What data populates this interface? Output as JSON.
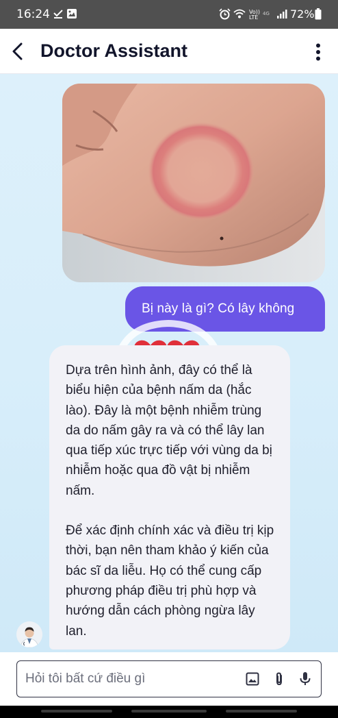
{
  "status_bar": {
    "time": "16:24",
    "battery": "72%",
    "left_icons": [
      "download-done-icon",
      "image-icon"
    ],
    "right_icons": [
      "alarm-icon",
      "wifi-icon",
      "volte-icon",
      "signal-icon",
      "battery-icon"
    ]
  },
  "header": {
    "title": "Doctor Assistant",
    "back_icon": "back-arrow-icon",
    "menu_icon": "more-vertical-icon"
  },
  "chat": {
    "messages": [
      {
        "role": "user",
        "type": "image",
        "description_icon": "photo"
      },
      {
        "role": "user",
        "type": "text",
        "text": "Bị này là gì? Có lây không"
      },
      {
        "role": "assistant",
        "type": "text",
        "paragraphs": [
          "Dựa trên hình ảnh, đây có thể là biểu hiện của bệnh nấm da (hắc lào). Đây là một bệnh nhiễm trùng da do nấm gây ra và có thể lây lan qua tiếp xúc trực tiếp với vùng da bị nhiễm hoặc qua đồ vật bị nhiễm nấm.",
          "Để xác định chính xác và điều trị kịp thời, bạn nên tham khảo ý kiến của bác sĩ da liễu. Họ có thể cung cấp phương pháp điều trị phù hợp và hướng dẫn cách phòng ngừa lây lan."
        ]
      }
    ]
  },
  "input": {
    "placeholder": "Hỏi tôi bất cứ điều gì",
    "value": "",
    "icons": [
      "image-icon",
      "attachment-icon",
      "microphone-icon"
    ]
  },
  "colors": {
    "status_bar": "#505050",
    "accent": "#6a55e6",
    "chat_bg": "#d8eefa",
    "bot_bubble": "#f2f2f7",
    "title": "#12152b"
  }
}
